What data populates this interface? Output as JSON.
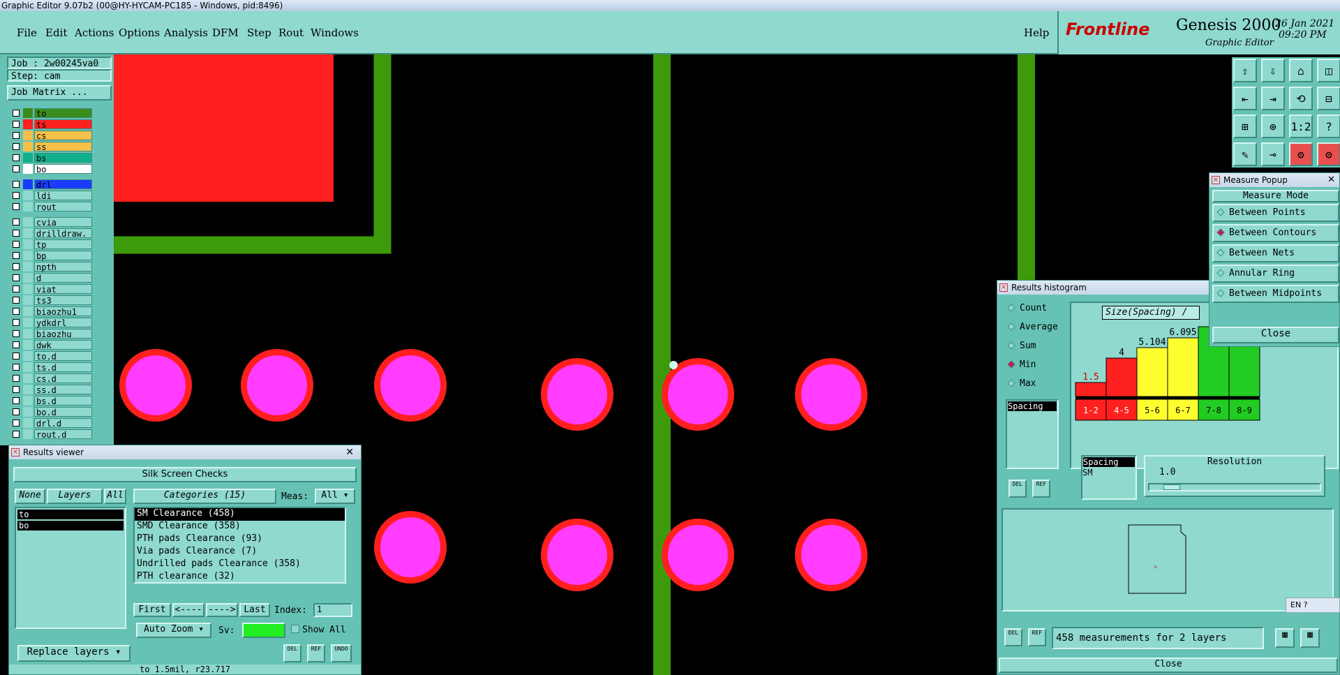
{
  "window_title": "Graphic Editor 9.07b2 (00@HY-HYCAM-PC185 - Windows, pid:8496)",
  "menu": [
    "File",
    "Edit",
    "Actions",
    "Options",
    "Analysis",
    "DFM",
    "Step",
    "Rout",
    "Windows"
  ],
  "help": "Help",
  "brand": {
    "logo": "Frontline",
    "product": "Genesis 2000",
    "subtitle": "Graphic Editor",
    "date": "26 Jan 2021",
    "time": "09:20 PM"
  },
  "job": "Job : 2w00245va0",
  "step": "Step: cam",
  "job_matrix": "Job Matrix ...",
  "layers": [
    {
      "name": "to",
      "color": "#3a8c1c"
    },
    {
      "name": "ts",
      "color": "#ff2020"
    },
    {
      "name": "cs",
      "color": "#f5c04a"
    },
    {
      "name": "ss",
      "color": "#f5c04a"
    },
    {
      "name": "bs",
      "color": "#12b08a"
    },
    {
      "name": "bo",
      "color": "#ffffff"
    },
    {
      "name": "drl",
      "color": "#1a3cff"
    },
    {
      "name": "ldi",
      "color": "#8fd9cf"
    },
    {
      "name": "rout",
      "color": "#8fd9cf"
    },
    {
      "name": "cvia",
      "color": "#8fd9cf"
    },
    {
      "name": "drilldraw.",
      "color": "#8fd9cf"
    },
    {
      "name": "tp",
      "color": "#8fd9cf"
    },
    {
      "name": "bp",
      "color": "#8fd9cf"
    },
    {
      "name": "npth",
      "color": "#8fd9cf"
    },
    {
      "name": "d",
      "color": "#8fd9cf"
    },
    {
      "name": "viat",
      "color": "#8fd9cf"
    },
    {
      "name": "ts3",
      "color": "#8fd9cf"
    },
    {
      "name": "biaozhu1",
      "color": "#8fd9cf"
    },
    {
      "name": "ydkdrl",
      "color": "#8fd9cf"
    },
    {
      "name": "biaozhu",
      "color": "#8fd9cf"
    },
    {
      "name": "dwk",
      "color": "#8fd9cf"
    },
    {
      "name": "to.d",
      "color": "#8fd9cf"
    },
    {
      "name": "ts.d",
      "color": "#8fd9cf"
    },
    {
      "name": "cs.d",
      "color": "#8fd9cf"
    },
    {
      "name": "ss.d",
      "color": "#8fd9cf"
    },
    {
      "name": "bs.d",
      "color": "#8fd9cf"
    },
    {
      "name": "bo.d",
      "color": "#8fd9cf"
    },
    {
      "name": "drl.d",
      "color": "#8fd9cf"
    },
    {
      "name": "rout.d",
      "color": "#8fd9cf"
    }
  ],
  "results_viewer": {
    "title": "Results viewer",
    "check": "Silk Screen Checks",
    "none": "None",
    "layers_label": "Layers",
    "all": "All",
    "categories_label": "Categories (15)",
    "meas_label": "Meas:",
    "meas_value": "All",
    "layer_list": [
      "to",
      "bo"
    ],
    "categories": [
      "SM Clearance (458)",
      "SMD Clearance (358)",
      "PTH pads Clearance (93)",
      "Via pads Clearance (7)",
      "Undrilled pads Clearance (358)",
      "PTH clearance (32)"
    ],
    "first": "First",
    "prev": "<----",
    "next": "---->",
    "last": "Last",
    "index_label": "Index:",
    "index_value": "1",
    "auto_zoom": "Auto Zoom",
    "sv": "Sv:",
    "show_all": "Show All",
    "replace_layers": "Replace layers",
    "status": "to 1.5mil, r23.717"
  },
  "histogram": {
    "title": "Results histogram",
    "modes": [
      "Count",
      "Average",
      "Sum",
      "Min",
      "Max"
    ],
    "selected_mode": "Min",
    "size_label": "Size(Spacing) /",
    "spacing": "Spacing",
    "list": [
      "Spacing",
      "SM"
    ],
    "resolution_label": "Resolution",
    "resolution_value": "1.0",
    "measurements": "458 measurements for 2 layers",
    "close": "Close",
    "del": "DEL",
    "ref": "REF"
  },
  "chart_data": {
    "type": "bar",
    "categories": [
      "1-2",
      "4-5",
      "5-6",
      "6-7",
      "7-8",
      "8-9"
    ],
    "values": [
      1.5,
      4,
      5.104,
      6.095,
      null,
      null
    ],
    "labels": [
      "1.5",
      "4",
      "5.104",
      "6.095",
      "",
      ""
    ],
    "colors": [
      "#ff2020",
      "#ff2020",
      "#ffff30",
      "#ffff30",
      "#22cc22",
      "#22cc22"
    ],
    "relative_heights": [
      0.2,
      0.55,
      0.7,
      0.84,
      1.0,
      1.0
    ]
  },
  "measure_popup": {
    "title": "Measure Popup",
    "header": "Measure Mode",
    "modes": [
      "Between Points",
      "Between Contours",
      "Between Nets",
      "Annular Ring",
      "Between Midpoints"
    ],
    "selected": "Between Contours",
    "close": "Close"
  },
  "ime": "EN"
}
